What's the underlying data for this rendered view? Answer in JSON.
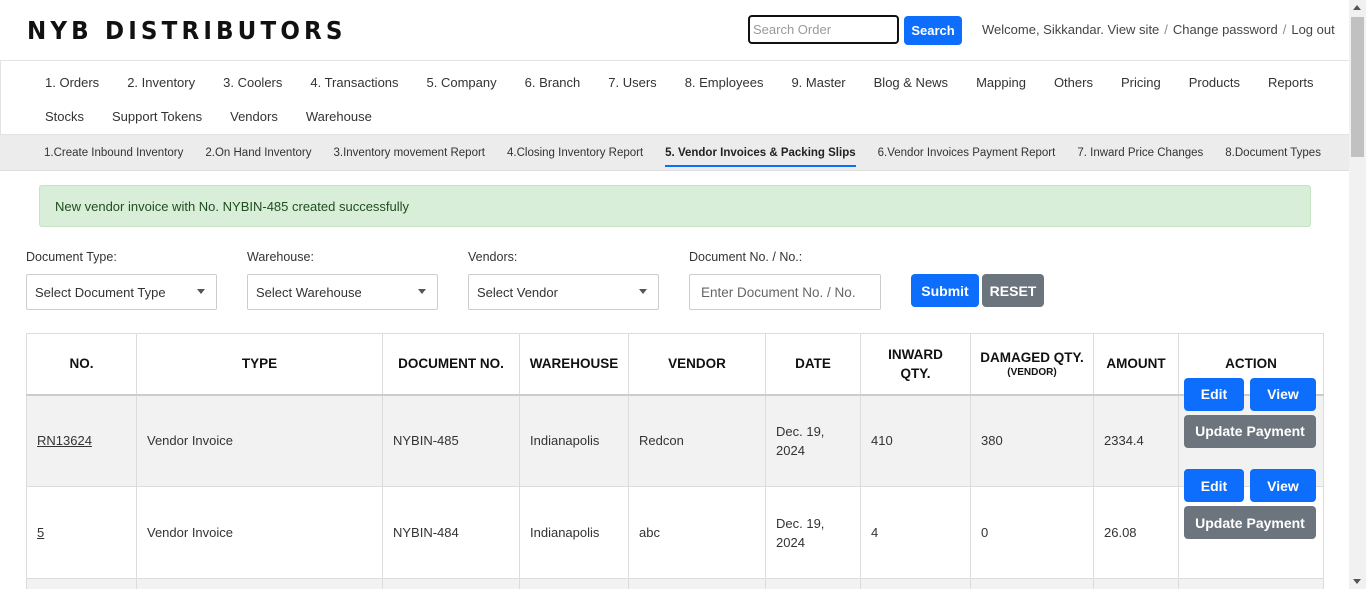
{
  "header": {
    "brand": "NYB DISTRIBUTORS",
    "search_placeholder": "Search Order",
    "search_label": "Search",
    "welcome": "Welcome, Sikkandar.",
    "view_site": "View site",
    "change_password": "Change password",
    "log_out": "Log out",
    "separator": "/"
  },
  "main_nav": {
    "row1": [
      "1. Orders",
      "2. Inventory",
      "3. Coolers",
      "4. Transactions",
      "5. Company",
      "6. Branch",
      "7. Users",
      "8. Employees",
      "9. Master",
      "Blog & News",
      "Mapping",
      "Others",
      "Pricing",
      "Products",
      "Reports"
    ],
    "row2": [
      "Stocks",
      "Support Tokens",
      "Vendors",
      "Warehouse"
    ]
  },
  "sub_nav": {
    "items": [
      "1.Create Inbound Inventory",
      "2.On Hand Inventory",
      "3.Inventory movement Report",
      "4.Closing Inventory Report",
      "5. Vendor Invoices & Packing Slips",
      "6.Vendor Invoices Payment Report",
      "7. Inward Price Changes",
      "8.Document Types"
    ],
    "active": "5. Vendor Invoices & Packing Slips"
  },
  "alert": {
    "message": "New vendor invoice with No. NYBIN-485 created successfully",
    "color": "#d9eed8"
  },
  "filters": {
    "document_type": {
      "label": "Document Type:",
      "value": "Select Document Type"
    },
    "warehouse": {
      "label": "Warehouse:",
      "value": "Select Warehouse"
    },
    "vendors": {
      "label": "Vendors:",
      "value": "Select Vendor"
    },
    "document_no": {
      "label": "Document No. / No.:",
      "placeholder": "Enter Document No. / No."
    },
    "submit_label": "Submit",
    "reset_label": "RESET"
  },
  "table": {
    "columns": {
      "no": "NO.",
      "type": "TYPE",
      "document_no": "DOCUMENT NO.",
      "warehouse": "WAREHOUSE",
      "vendor": "VENDOR",
      "date": "DATE",
      "inward_qty_1": "INWARD",
      "inward_qty_2": "QTY.",
      "damaged_qty": "DAMAGED QTY.",
      "damaged_qty_sub": "(VENDOR)",
      "amount": "AMOUNT",
      "action": "ACTION"
    },
    "rows": [
      {
        "no": "RN13624",
        "type": "Vendor Invoice",
        "document_no": "NYBIN-485",
        "warehouse": "Indianapolis",
        "vendor": "Redcon",
        "date_1": "Dec. 19,",
        "date_2": "2024",
        "inward_qty": "410",
        "damaged_qty": "380",
        "amount": "2334.4"
      },
      {
        "no": "5",
        "type": "Vendor Invoice",
        "document_no": "NYBIN-484",
        "warehouse": "Indianapolis",
        "vendor": "abc",
        "date_1": "Dec. 19,",
        "date_2": "2024",
        "inward_qty": "4",
        "damaged_qty": "0",
        "amount": "26.08"
      }
    ],
    "actions": {
      "edit": "Edit",
      "view": "View",
      "update_payment": "Update Payment"
    }
  },
  "colors": {
    "primary": "#0d6efd",
    "secondary": "#6c757d",
    "success_bg": "#d9eed8"
  }
}
